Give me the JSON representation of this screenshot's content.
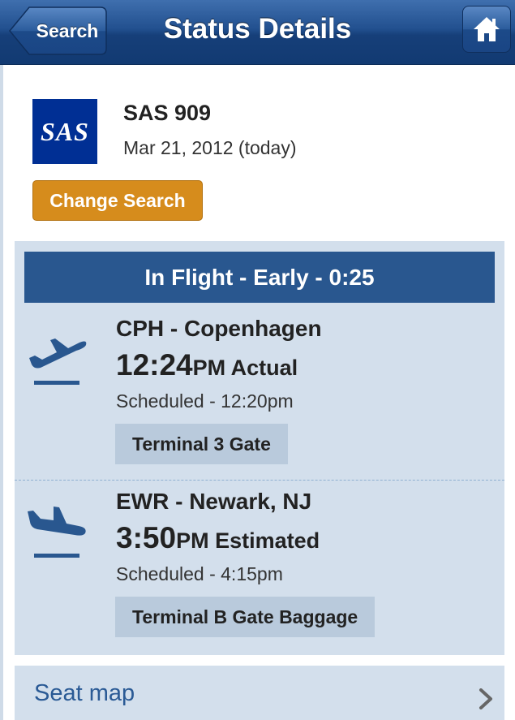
{
  "nav": {
    "back_label": "Search",
    "title": "Status Details"
  },
  "flight": {
    "airline_logo_text": "SAS",
    "number": "SAS 909",
    "date": "Mar 21, 2012 (today)",
    "change_search_label": "Change Search"
  },
  "status": {
    "text": "In Flight - Early - 0:25",
    "departure": {
      "airport": "CPH - Copenhagen",
      "time": "12:24",
      "time_suffix": "PM Actual",
      "scheduled": "Scheduled - 12:20pm",
      "gate_info": "Terminal 3 Gate"
    },
    "arrival": {
      "airport": "EWR - Newark, NJ",
      "time": "3:50",
      "time_suffix": "PM Estimated",
      "scheduled": "Scheduled - 4:15pm",
      "gate_info": "Terminal B Gate Baggage"
    }
  },
  "links": {
    "seat_map": "Seat map"
  },
  "colors": {
    "navbar": "#22508f",
    "status_bar": "#29578f",
    "panel": "#d3dfec",
    "badge": "#b9cadc",
    "change_button": "#d68c1c",
    "sas_blue": "#002f94",
    "link": "#2a5a95"
  },
  "icons": [
    "back-arrow-icon",
    "home-icon",
    "takeoff-icon",
    "landing-icon",
    "chevron-right-icon"
  ]
}
